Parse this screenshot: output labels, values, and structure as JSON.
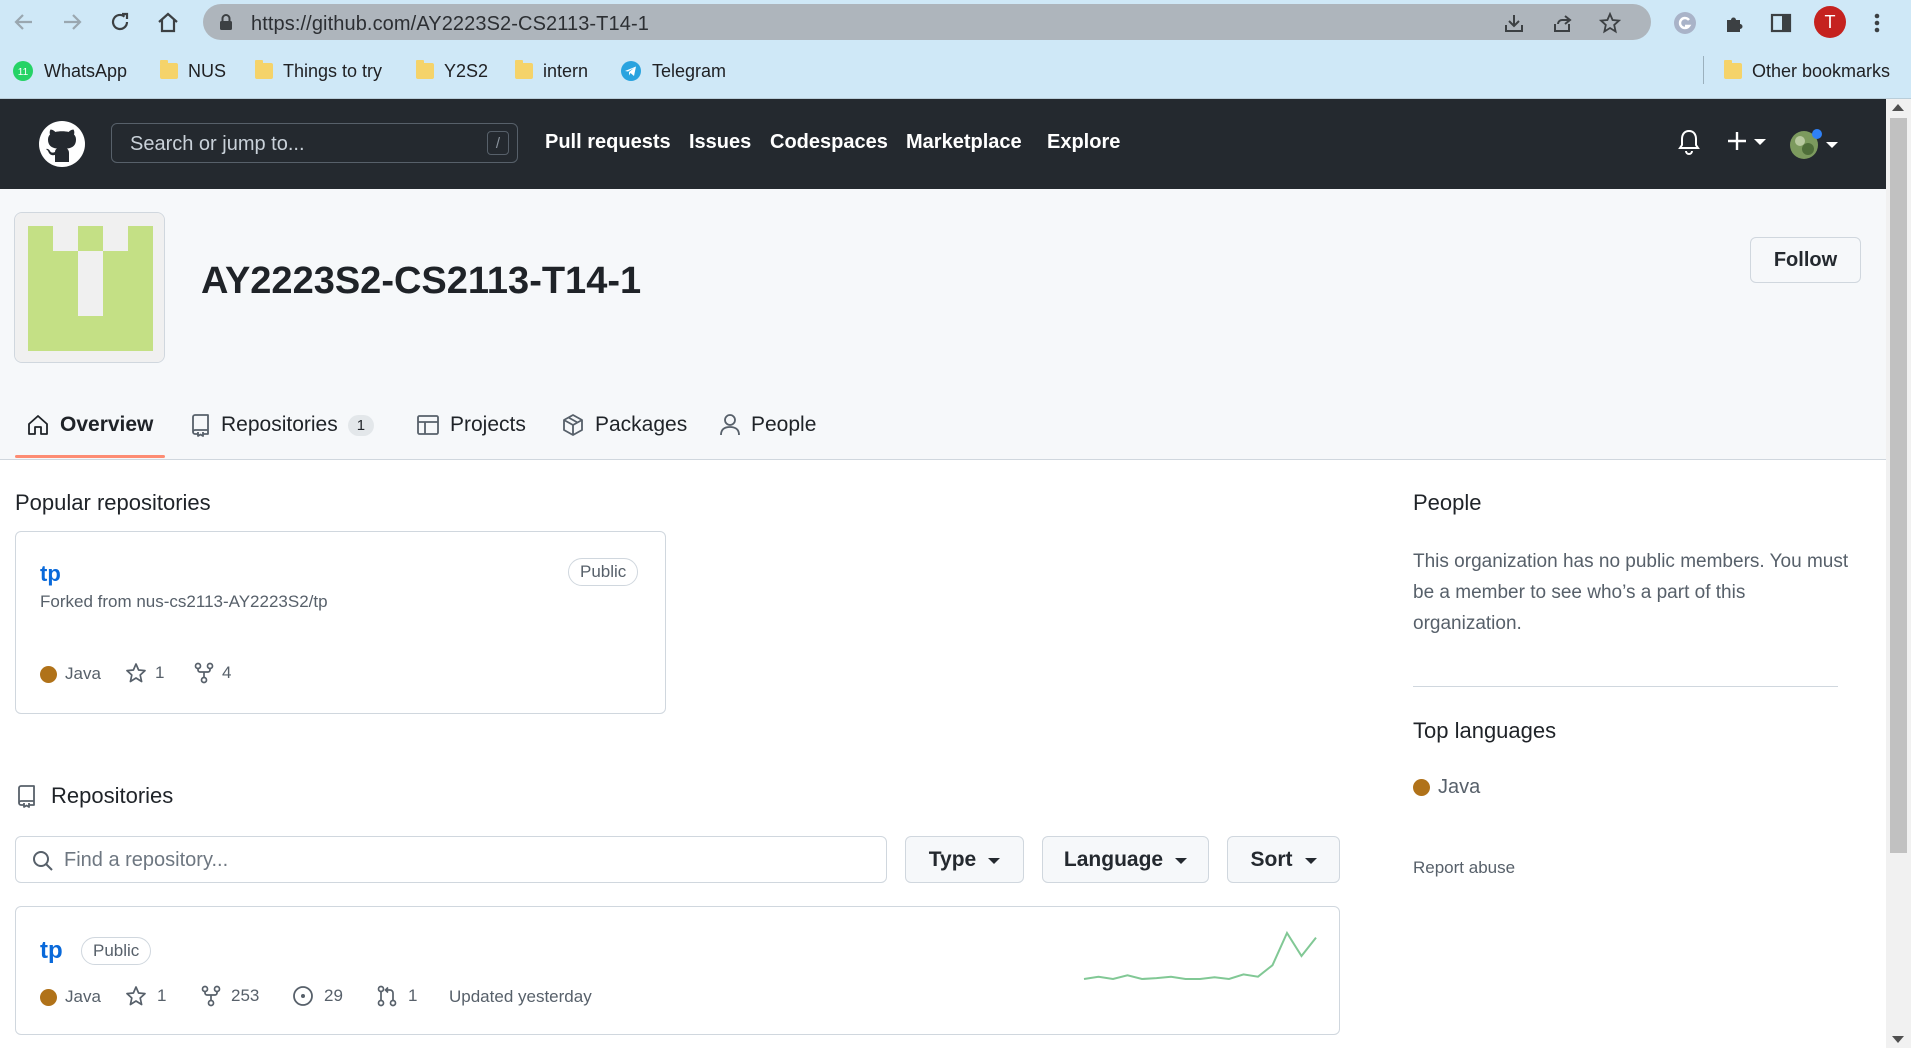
{
  "browser": {
    "url": "https://github.com/AY2223S2-CS2113-T14-1",
    "profile_initial": "T",
    "bookmarks": [
      {
        "label": "WhatsApp",
        "icon": "whatsapp-icon"
      },
      {
        "label": "NUS",
        "icon": "folder-icon"
      },
      {
        "label": "Things to try",
        "icon": "folder-icon"
      },
      {
        "label": "Y2S2",
        "icon": "folder-icon"
      },
      {
        "label": "intern",
        "icon": "folder-icon"
      },
      {
        "label": "Telegram",
        "icon": "telegram-icon"
      }
    ],
    "other_bookmarks": "Other bookmarks",
    "whatsapp_badge": "11"
  },
  "header": {
    "search_placeholder": "Search or jump to...",
    "search_shortcut": "/",
    "nav": [
      "Pull requests",
      "Issues",
      "Codespaces",
      "Marketplace",
      "Explore"
    ]
  },
  "org": {
    "name": "AY2223S2-CS2113-T14-1",
    "follow_label": "Follow",
    "avatar_color": "#c4e085",
    "tabs": [
      {
        "label": "Overview",
        "icon": "home-icon",
        "selected": true
      },
      {
        "label": "Repositories",
        "icon": "repo-icon",
        "count": "1"
      },
      {
        "label": "Projects",
        "icon": "table-icon"
      },
      {
        "label": "Packages",
        "icon": "package-icon"
      },
      {
        "label": "People",
        "icon": "person-icon"
      }
    ]
  },
  "popular": {
    "title": "Popular repositories",
    "repo": {
      "name": "tp",
      "visibility": "Public",
      "forked_from": "Forked from nus-cs2113-AY2223S2/tp",
      "language": "Java",
      "language_color": "#b07219",
      "stars": "1",
      "forks": "4"
    }
  },
  "repositories": {
    "title": "Repositories",
    "find_placeholder": "Find a repository...",
    "filters": [
      "Type",
      "Language",
      "Sort"
    ],
    "items": [
      {
        "name": "tp",
        "visibility": "Public",
        "language": "Java",
        "stars": "1",
        "forks": "253",
        "issues": "29",
        "pull_requests": "1",
        "updated": "Updated yesterday",
        "activity": [
          0,
          0.05,
          0,
          0.08,
          0,
          0.02,
          0.05,
          0,
          0,
          0.04,
          0,
          0.1,
          0.05,
          0.3,
          1.0,
          0.5,
          0.9
        ]
      }
    ]
  },
  "sidebar": {
    "people_title": "People",
    "people_text": "This organization has no public members. You must be a member to see who’s a part of this organization.",
    "languages_title": "Top languages",
    "top_language": "Java",
    "report_abuse": "Report abuse"
  }
}
